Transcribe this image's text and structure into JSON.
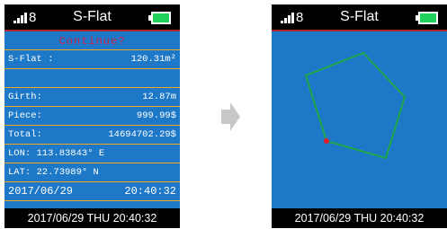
{
  "colors": {
    "screen_bg": "#000000",
    "content_bg": "#1e78c8",
    "row_separator": "#f5a623",
    "header_line": "#b0242a",
    "battery_fill": "#1fd15a",
    "continue_text": "#c8234a",
    "polygon_stroke": "#1fa84a",
    "start_point": "#e0202a",
    "arrow": "#c8c8c8"
  },
  "left_screen": {
    "status": {
      "signal_icon": "signal-bars-icon",
      "signal_count": "8",
      "title": "S-Flat",
      "battery_icon": "battery-icon"
    },
    "prompt": "Continue?",
    "area_label": "S-Flat :",
    "area_value": "120.31m²",
    "girth_label": "Girth:",
    "girth_value": "12.87m",
    "piece_label": "Piece:",
    "piece_value": "999.99$",
    "total_label": "Total:",
    "total_value": "14694702.29$",
    "lon": "LON: 113.83843° E",
    "lat": "LAT: 22.73989° N",
    "date": "2017/06/29",
    "time": "20:40:32",
    "footer": "2017/06/29  THU 20:40:32"
  },
  "right_screen": {
    "status": {
      "signal_icon": "signal-bars-icon",
      "signal_count": "8",
      "title": "S-Flat",
      "battery_icon": "battery-icon"
    },
    "footer": "2017/06/29  THU 20:40:32"
  },
  "arrow_icon": "right-arrow-icon"
}
